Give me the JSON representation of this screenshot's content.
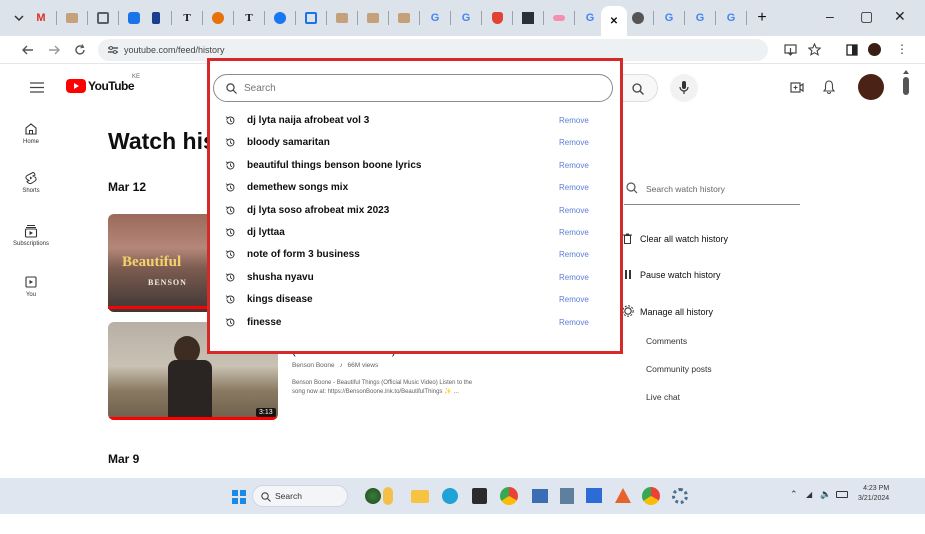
{
  "browser": {
    "url": "youtube.com/feed/history",
    "tabs": [
      "M",
      "T",
      "T",
      "G",
      "G",
      "G",
      "G",
      "G",
      "G"
    ],
    "win_controls": {
      "min": "–",
      "max": "▢",
      "close": "✕"
    },
    "new_tab": "+"
  },
  "youtube": {
    "logo_text": "YouTube",
    "region": "KE",
    "page_title": "Watch his",
    "sidebar": [
      {
        "label": "Home",
        "icon": "home-icon"
      },
      {
        "label": "Shorts",
        "icon": "shorts-icon"
      },
      {
        "label": "Subscriptions",
        "icon": "subscriptions-icon"
      },
      {
        "label": "You",
        "icon": "you-icon"
      }
    ],
    "dates": {
      "first": "Mar 12",
      "second": "Mar 9"
    },
    "video": {
      "thumb_text_1": "Beautiful",
      "thumb_text_2": "BENSON",
      "title_partial": "(Official Music Video)",
      "channel": "Benson Boone",
      "views": "66M views",
      "desc_line1": "Benson Boone - Beautiful Things (Official Music Video) Listen to the",
      "desc_line2": "song now at: https://BensonBoone.lnk.to/BeautifulThings",
      "duration": "3:13"
    }
  },
  "search": {
    "placeholder": "Search",
    "suggestions": [
      {
        "text": "dj lyta naija afrobeat vol 3",
        "action": "Remove"
      },
      {
        "text": "bloody samaritan",
        "action": "Remove"
      },
      {
        "text": "beautiful things benson boone lyrics",
        "action": "Remove"
      },
      {
        "text": "demethew songs mix",
        "action": "Remove"
      },
      {
        "text": "dj lyta soso afrobeat mix 2023",
        "action": "Remove"
      },
      {
        "text": "dj lyttaa",
        "action": "Remove"
      },
      {
        "text": "note of form 3 business",
        "action": "Remove"
      },
      {
        "text": "shusha nyavu",
        "action": "Remove"
      },
      {
        "text": "kings disease",
        "action": "Remove"
      },
      {
        "text": "finesse",
        "action": "Remove"
      }
    ]
  },
  "history_panel": {
    "search_placeholder": "Search watch history",
    "clear": "Clear all watch history",
    "pause": "Pause watch history",
    "manage": "Manage all history",
    "comments": "Comments",
    "community": "Community posts",
    "live": "Live chat"
  },
  "taskbar": {
    "search_label": "Search",
    "time": "4:23 PM",
    "date": "3/21/2024"
  },
  "colors": {
    "highlight_border": "#d62a2a",
    "yt_red": "#ff0000",
    "remove_link": "#5b7fd4"
  }
}
